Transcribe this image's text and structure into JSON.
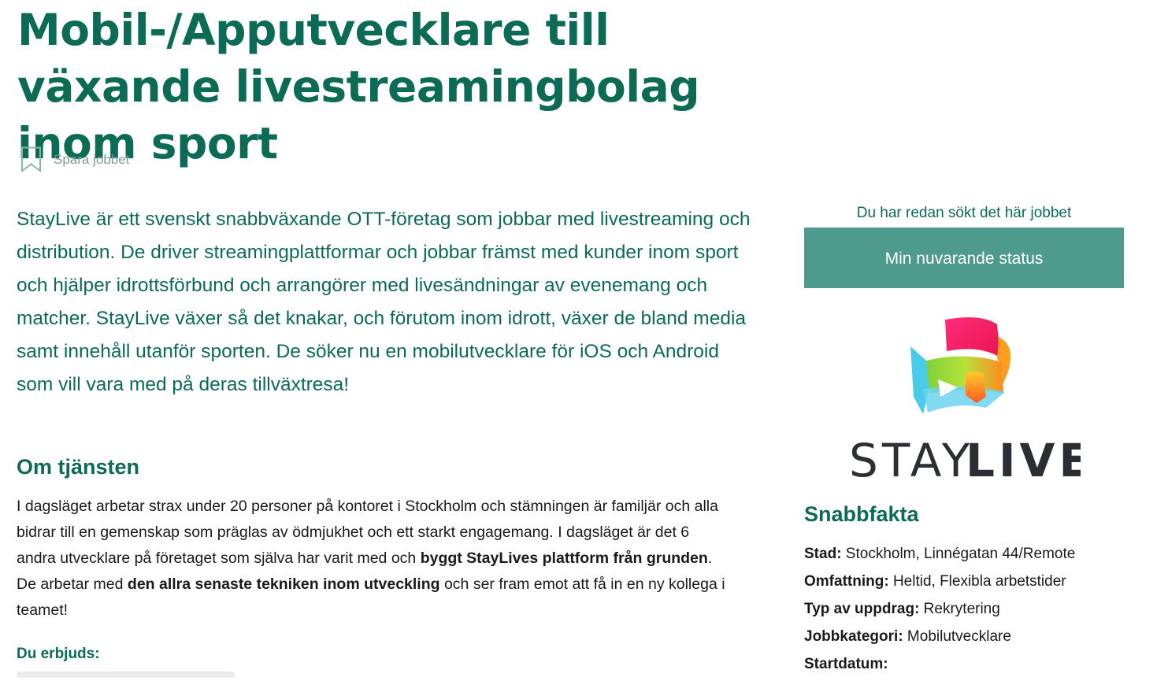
{
  "job": {
    "title": "Mobil-/Apputvecklare till växande livestreamingbolag inom sport",
    "save_label": "Spara jobbet",
    "intro": "StayLive är ett svenskt snabbväxande OTT-företag som jobbar med livestreaming och distribution. De driver streamingplattformar och jobbar främst med kunder inom sport och hjälper idrottsförbund och arrangörer med livesändningar av evenemang och matcher. StayLive växer så det knakar, och förutom inom idrott, växer de bland media samt innehåll utanför sporten. De söker nu en mobilutvecklare för iOS och Android som vill vara med på deras tillväxtresa!",
    "section_title": "Om tjänsten",
    "body": {
      "p1": "I dagsläget arbetar strax under 20 personer på kontoret i Stockholm och stämningen är familjär och alla bidrar till en gemenskap som präglas av ödmjukhet och ett starkt engagemang. I dagsläget är det 6 andra utvecklare på företaget som själva har varit med och ",
      "b1": "byggt StayLives plattform från grunden",
      "p2": ". De arbetar med ",
      "b2": "den allra senaste tekniken inom utveckling",
      "p3": " och ser fram emot att få in en ny kollega i teamet!"
    },
    "offer_title": "Du erbjuds:"
  },
  "sidebar": {
    "applied_text": "Du har redan sökt det här jobbet",
    "status_button": "Min nuvarande status",
    "logo": {
      "name": "staylive-logo",
      "text_light": "STAY",
      "text_bold": "LIVE"
    },
    "facts_title": "Snabbfakta",
    "facts": [
      {
        "key": "Stad",
        "value": "Stockholm, Linnégatan 44/Remote"
      },
      {
        "key": "Omfattning",
        "value": "Heltid, Flexibla arbetstider"
      },
      {
        "key": "Typ av uppdrag",
        "value": "Rekrytering"
      },
      {
        "key": "Jobbkategori",
        "value": "Mobilutvecklare"
      },
      {
        "key": "Startdatum",
        "value": ""
      }
    ]
  },
  "colors": {
    "brand_green": "#0b6b54",
    "button_teal": "#4e9a8d",
    "muted": "#7b9e93"
  }
}
